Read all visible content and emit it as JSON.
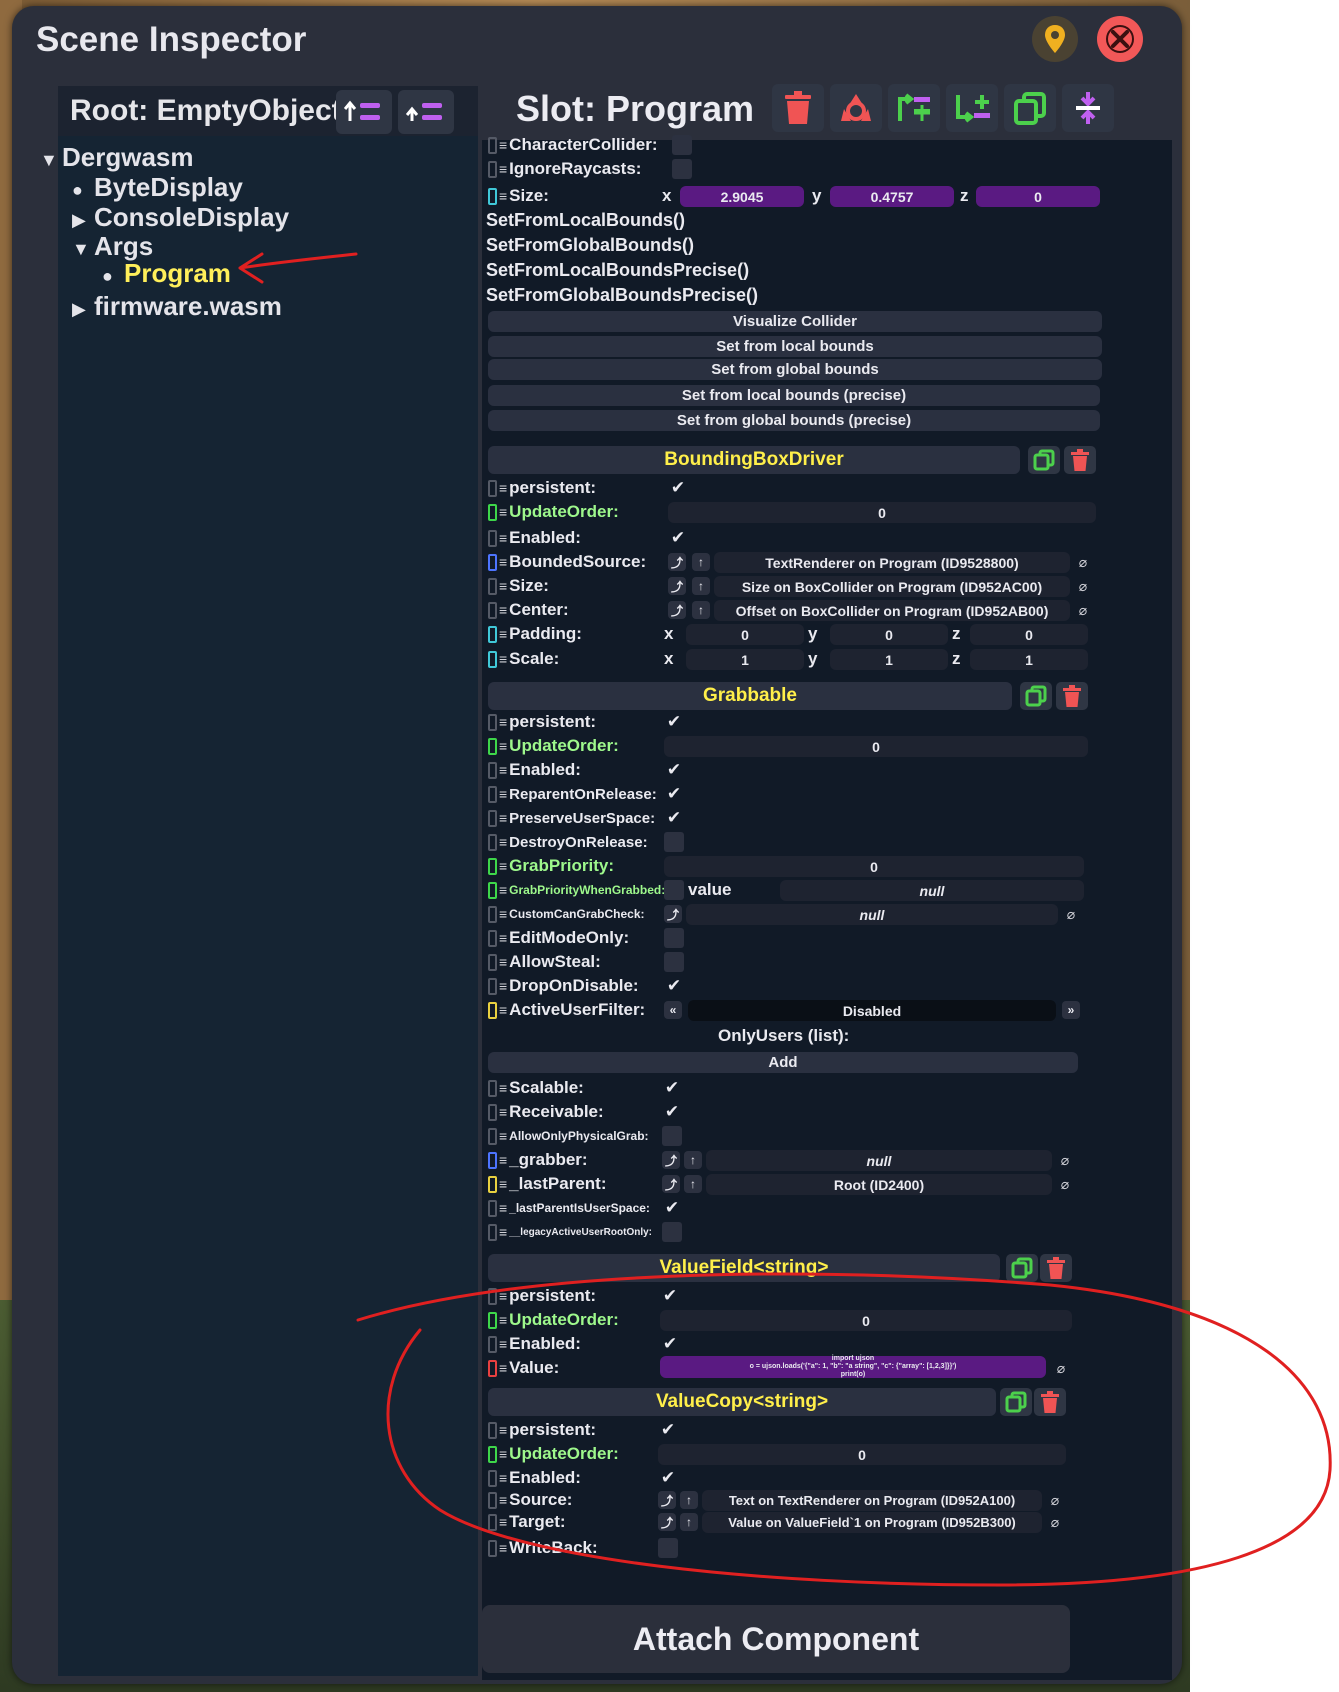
{
  "window": {
    "title": "Scene Inspector"
  },
  "colors": {
    "panel": "#2b2f3b",
    "hierarchy": "#152433",
    "inspector": "#111a27",
    "accent_yellow": "#ffef4a",
    "accent_green": "#3ed64a",
    "accent_red": "#f25858",
    "accent_purple": "#5a1a82",
    "annotation_red": "#e02020"
  },
  "hierarchy": {
    "root_label": "Root: EmptyObject",
    "items": [
      {
        "label": "Dergwasm",
        "marker": "▼"
      },
      {
        "label": "ByteDisplay",
        "marker": "●"
      },
      {
        "label": "ConsoleDisplay",
        "marker": "▶"
      },
      {
        "label": "Args",
        "marker": "▼"
      },
      {
        "label": "Program",
        "marker": "●"
      },
      {
        "label": "firmware.wasm",
        "marker": "▶"
      }
    ]
  },
  "inspector": {
    "slot_label": "Slot: Program",
    "collider": {
      "character_collider": "CharacterCollider:",
      "ignore_raycasts": "IgnoreRaycasts:",
      "size_label": "Size:",
      "size_x": "2.9045",
      "size_y": "0.4757",
      "size_z": "0",
      "methods": [
        "SetFromLocalBounds()",
        "SetFromGlobalBounds()",
        "SetFromLocalBoundsPrecise()",
        "SetFromGlobalBoundsPrecise()"
      ],
      "buttons": [
        "Visualize Collider",
        "Set from local bounds",
        "Set from global bounds",
        "Set from local bounds (precise)",
        "Set from global bounds (precise)"
      ]
    },
    "bbd": {
      "title": "BoundingBoxDriver",
      "persistent": "persistent:",
      "update_order": "UpdateOrder:",
      "update_order_value": "0",
      "enabled": "Enabled:",
      "bounded_source": "BoundedSource:",
      "bounded_source_value": "TextRenderer on Program (ID9528800)",
      "size": "Size:",
      "size_value": "Size on BoxCollider on Program (ID952AC00)",
      "center": "Center:",
      "center_value": "Offset on BoxCollider on Program (ID952AB00)",
      "padding": "Padding:",
      "padding_x": "0",
      "padding_y": "0",
      "padding_z": "0",
      "scale": "Scale:",
      "scale_x": "1",
      "scale_y": "1",
      "scale_z": "1"
    },
    "grab": {
      "title": "Grabbable",
      "persistent": "persistent:",
      "update_order": "UpdateOrder:",
      "update_order_value": "0",
      "enabled": "Enabled:",
      "reparent": "ReparentOnRelease:",
      "preserve": "PreserveUserSpace:",
      "destroy": "DestroyOnRelease:",
      "priority": "GrabPriority:",
      "priority_value": "0",
      "priority_grabbed": "GrabPriorityWhenGrabbed:",
      "value_word": "value",
      "priority_grabbed_value": "null",
      "custom_check": "CustomCanGrabCheck:",
      "custom_check_value": "null",
      "edit_mode": "EditModeOnly:",
      "allow_steal": "AllowSteal:",
      "drop_disable": "DropOnDisable:",
      "active_filter": "ActiveUserFilter:",
      "active_filter_value": "Disabled",
      "only_users": "OnlyUsers (list):",
      "add": "Add",
      "scalable": "Scalable:",
      "receivable": "Receivable:",
      "allow_physical": "AllowOnlyPhysicalGrab:",
      "grabber": "_grabber:",
      "grabber_value": "null",
      "last_parent": "_lastParent:",
      "last_parent_value": "Root (ID2400)",
      "last_parent_user": "_lastParentIsUserSpace:",
      "legacy": "__legacyActiveUserRootOnly:"
    },
    "vfield": {
      "title": "ValueField<string>",
      "persistent": "persistent:",
      "update_order": "UpdateOrder:",
      "update_order_value": "0",
      "enabled": "Enabled:",
      "value": "Value:",
      "value_lines": [
        "import ujson",
        "o = ujson.loads('{\"a\": 1, \"b\": \"a string\", \"c\": {\"array\": [1,2,3]}}')",
        "print(o)"
      ]
    },
    "vcopy": {
      "title": "ValueCopy<string>",
      "persistent": "persistent:",
      "update_order": "UpdateOrder:",
      "update_order_value": "0",
      "enabled": "Enabled:",
      "source": "Source:",
      "source_value": "Text on TextRenderer on Program (ID952A100)",
      "target": "Target:",
      "target_value": "Value on ValueField`1 on Program (ID952B300)",
      "writeback": "WriteBack:"
    },
    "attach_label": "Attach Component"
  }
}
